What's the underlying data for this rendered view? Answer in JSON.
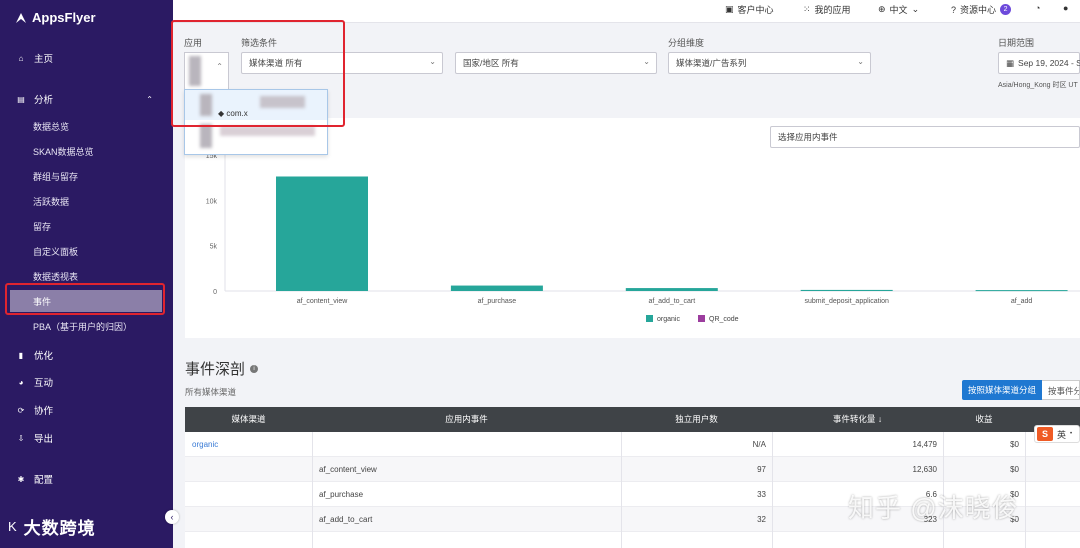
{
  "app": {
    "brand": "AppsFlyer"
  },
  "topbar": {
    "customer_center": "客户中心",
    "my_apps": "我的应用",
    "language": "中文",
    "resource_center": "资源中心",
    "resource_badge": "2"
  },
  "sidebar": {
    "home": "主页",
    "analysis": "分析",
    "sub_items": [
      "数据总览",
      "SKAN数据总览",
      "群组与留存",
      "活跃数据",
      "留存",
      "自定义面板",
      "数据透视表",
      "事件",
      "PBA（基于用户的归因）"
    ],
    "active_index": 7,
    "optimize": "优化",
    "engage": "互动",
    "collaborate": "协作",
    "export": "导出",
    "config": "配置"
  },
  "filters": {
    "app_label": "应用",
    "filter_label": "筛选条件",
    "media_source_value": "媒体渠道  所有",
    "country_value": "国家/地区  所有",
    "group_label": "分组维度",
    "group_value": "媒体渠道/广告系列",
    "date_label": "日期范围",
    "date_value": "Sep 19, 2024 - S",
    "timezone": "Asia/Hong_Kong 时区 UT",
    "dropdown_option": "com.x"
  },
  "event_search": {
    "placeholder": "选择应用内事件"
  },
  "chart_data": {
    "type": "bar",
    "categories": [
      "af_content_view",
      "af_purchase",
      "af_add_to_cart",
      "submit_deposit_application",
      "af_add"
    ],
    "series": [
      {
        "name": "organic",
        "values": [
          12630,
          600,
          323,
          120,
          100
        ]
      },
      {
        "name": "QR_code",
        "values": [
          0,
          0,
          0,
          0,
          0
        ]
      }
    ],
    "yticks": [
      "0",
      "5k",
      "10k",
      "15k"
    ],
    "ylim": [
      0,
      15000
    ],
    "colors": {
      "organic": "#26a69a",
      "QR_code": "#9c3d9e"
    },
    "legend": "bottom"
  },
  "section": {
    "title": "事件深剖",
    "subtitle": "所有媒体渠道",
    "group_by_media_button": "按照媒体渠道分组",
    "group_by_event_button": "按事件分"
  },
  "table": {
    "headers": [
      "媒体渠道",
      "应用内事件",
      "独立用户数",
      "事件转化量",
      "收益"
    ],
    "rows": [
      {
        "media": "organic",
        "event": "",
        "users": "N/A",
        "conversions": "14,479",
        "revenue": "$0"
      },
      {
        "media": "",
        "event": "af_content_view",
        "users": "97",
        "conversions": "12,630",
        "revenue": "$0"
      },
      {
        "media": "",
        "event": "af_purchase",
        "users": "33",
        "conversions": "6.6",
        "revenue": "$0"
      },
      {
        "media": "",
        "event": "af_add_to_cart",
        "users": "32",
        "conversions": "323",
        "revenue": "$0"
      }
    ]
  },
  "overlays": {
    "ime_label": "英",
    "watermark_left": "大数跨境",
    "watermark_right": "知乎 @沫晓俊"
  }
}
